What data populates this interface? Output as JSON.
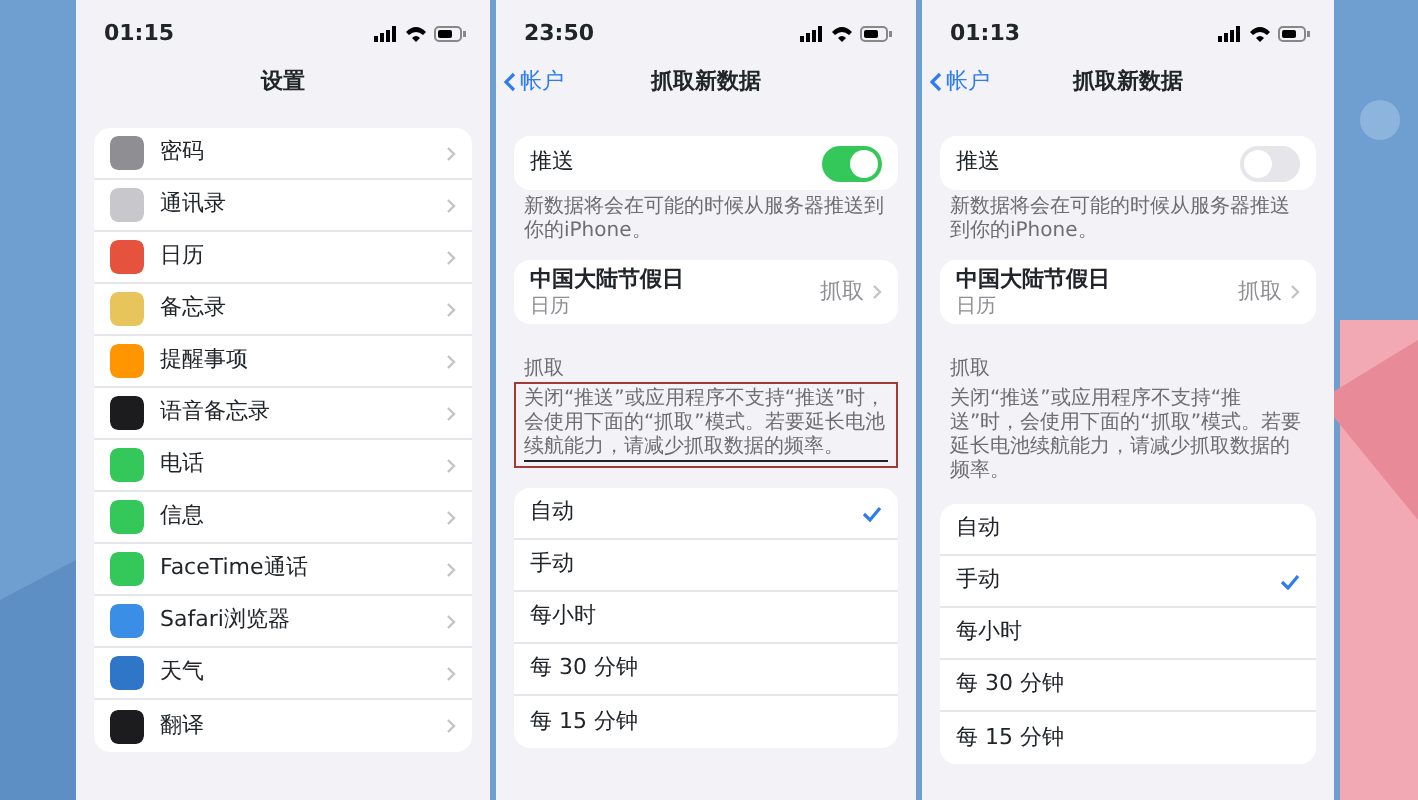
{
  "screens": [
    {
      "kind": "settings",
      "time": "01:15",
      "title": "设置",
      "items": [
        {
          "label": "密码",
          "color": "#8e8e93"
        },
        {
          "label": "通讯录",
          "color": "#c7c7cc"
        },
        {
          "label": "日历",
          "color": "#e5533f"
        },
        {
          "label": "备忘录",
          "color": "#e8c55a"
        },
        {
          "label": "提醒事项",
          "color": "#ff9500"
        },
        {
          "label": "语音备忘录",
          "color": "#1c1c1e"
        },
        {
          "label": "电话",
          "color": "#34c759"
        },
        {
          "label": "信息",
          "color": "#34c759"
        },
        {
          "label": "FaceTime通话",
          "color": "#34c759"
        },
        {
          "label": "Safari浏览器",
          "color": "#3a8ee6"
        },
        {
          "label": "天气",
          "color": "#2f76c9"
        },
        {
          "label": "翻译",
          "color": "#1c1c1e"
        }
      ]
    },
    {
      "kind": "fetch",
      "time": "23:50",
      "back": "帐户",
      "title": "抓取新数据",
      "push": {
        "label": "推送",
        "on": true
      },
      "push_note": "新数据将会在可能的时候从服务器推送到你的iPhone。",
      "calendar": {
        "name": "中国大陆节假日",
        "sub": "日历",
        "value": "抓取"
      },
      "section": "抓取",
      "note": "关闭“推送”或应用程序不支持“推送”时，会使用下面的“抓取”模式。若要延长电池续航能力，请减少抓取数据的频率。",
      "highlighted": true,
      "options": [
        {
          "label": "自动",
          "selected": true
        },
        {
          "label": "手动",
          "selected": false
        },
        {
          "label": "每小时",
          "selected": false
        },
        {
          "label": "每 30 分钟",
          "selected": false
        },
        {
          "label": "每 15 分钟",
          "selected": false
        }
      ]
    },
    {
      "kind": "fetch",
      "time": "01:13",
      "back": "帐户",
      "title": "抓取新数据",
      "push": {
        "label": "推送",
        "on": false
      },
      "push_note": "新数据将会在可能的时候从服务器推送到你的iPhone。",
      "calendar": {
        "name": "中国大陆节假日",
        "sub": "日历",
        "value": "抓取"
      },
      "section": "抓取",
      "note": "关闭“推送”或应用程序不支持“推送”时，会使用下面的“抓取”模式。若要延长电池续航能力，请减少抓取数据的频率。",
      "highlighted": false,
      "options": [
        {
          "label": "自动",
          "selected": false
        },
        {
          "label": "手动",
          "selected": true
        },
        {
          "label": "每小时",
          "selected": false
        },
        {
          "label": "每 30 分钟",
          "selected": false
        },
        {
          "label": "每 15 分钟",
          "selected": false
        }
      ]
    }
  ]
}
